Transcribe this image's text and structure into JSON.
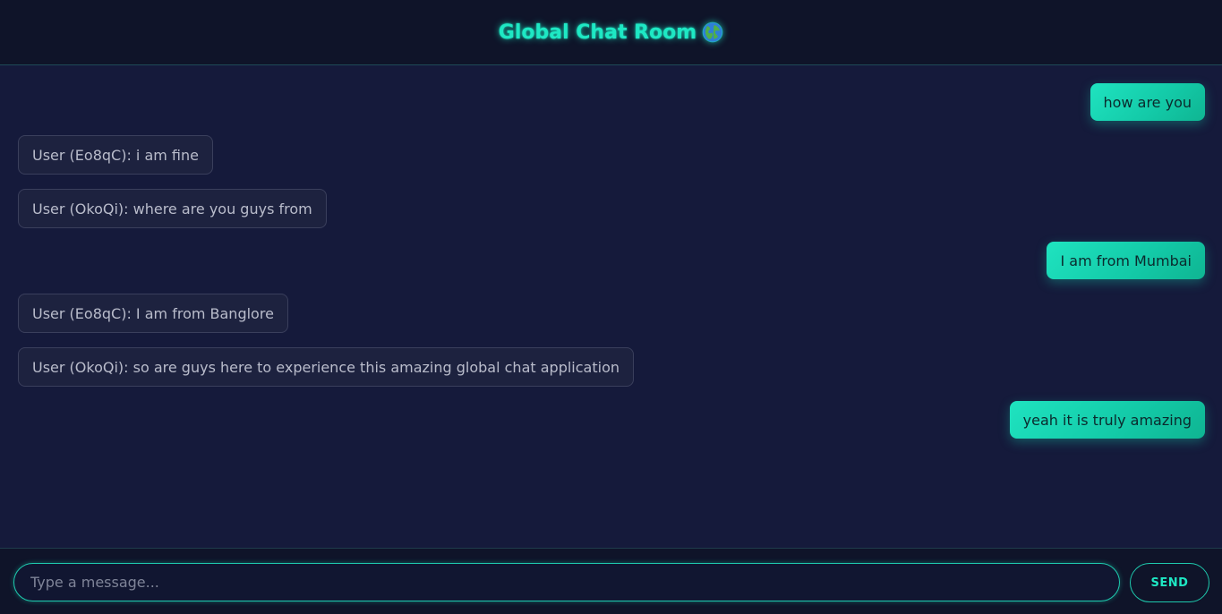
{
  "header": {
    "title": "Global Chat Room",
    "icon": "globe-icon"
  },
  "messages": [
    {
      "sender": "self",
      "text": "how are you"
    },
    {
      "sender": "other",
      "text": "User (Eo8qC): i am fine"
    },
    {
      "sender": "other",
      "text": "User (OkoQi): where are you guys from"
    },
    {
      "sender": "self",
      "text": "I am from Mumbai"
    },
    {
      "sender": "other",
      "text": "User (Eo8qC): I am from Banglore"
    },
    {
      "sender": "other",
      "text": "User (OkoQi): so are guys here to experience this amazing global chat application"
    },
    {
      "sender": "self",
      "text": "yeah it is truly amazing"
    }
  ],
  "composer": {
    "placeholder": "Type a message...",
    "value": "",
    "send_label": "SEND"
  },
  "colors": {
    "accent": "#1ee8c4",
    "background": "#151a3b",
    "header_bg": "#0f1429",
    "other_bubble": "#1d223f"
  }
}
